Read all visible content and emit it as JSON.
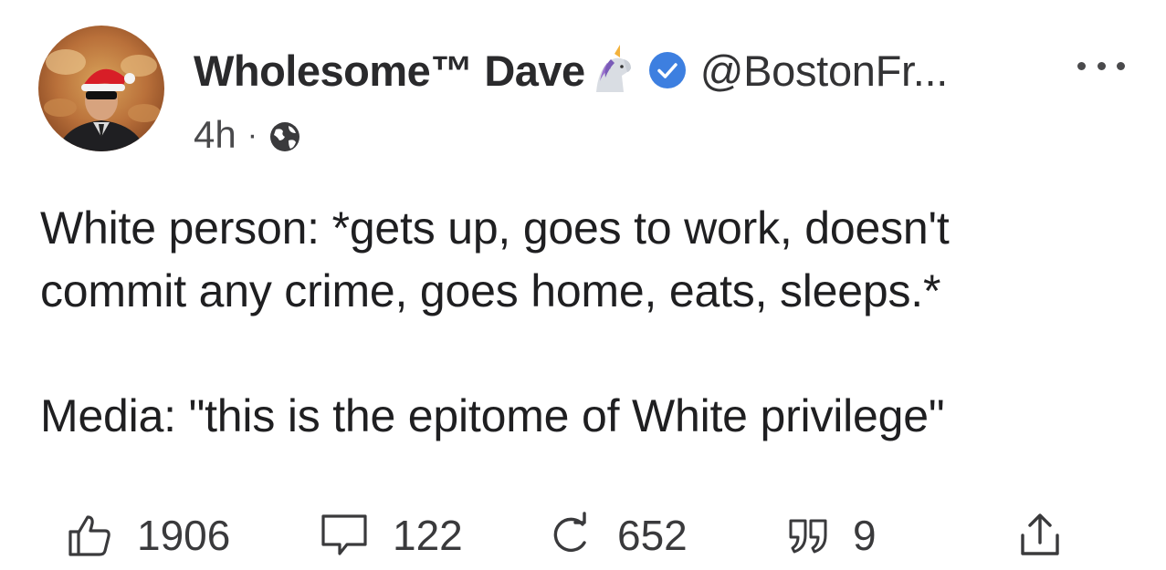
{
  "post": {
    "author": {
      "display_name": "Wholesome™ Dave",
      "handle": "@BostonFr...",
      "avatar_icon": "avatar-santa-hat-sunglasses",
      "name_emoji_icon": "unicorn-icon",
      "verified_icon": "verified-badge-icon",
      "verified_color": "#3d7fe0"
    },
    "time": "4h",
    "separator": "·",
    "visibility_icon": "globe-icon",
    "text": {
      "line1": "White person: *gets up, goes to work, doesn't",
      "line2": "commit any crime, goes home, eats, sleeps.*",
      "line3": "Media: \"this is the epitome of White privilege\""
    },
    "actions": {
      "likes": "1906",
      "comments": "122",
      "reposts": "652",
      "quotes": "9"
    }
  }
}
